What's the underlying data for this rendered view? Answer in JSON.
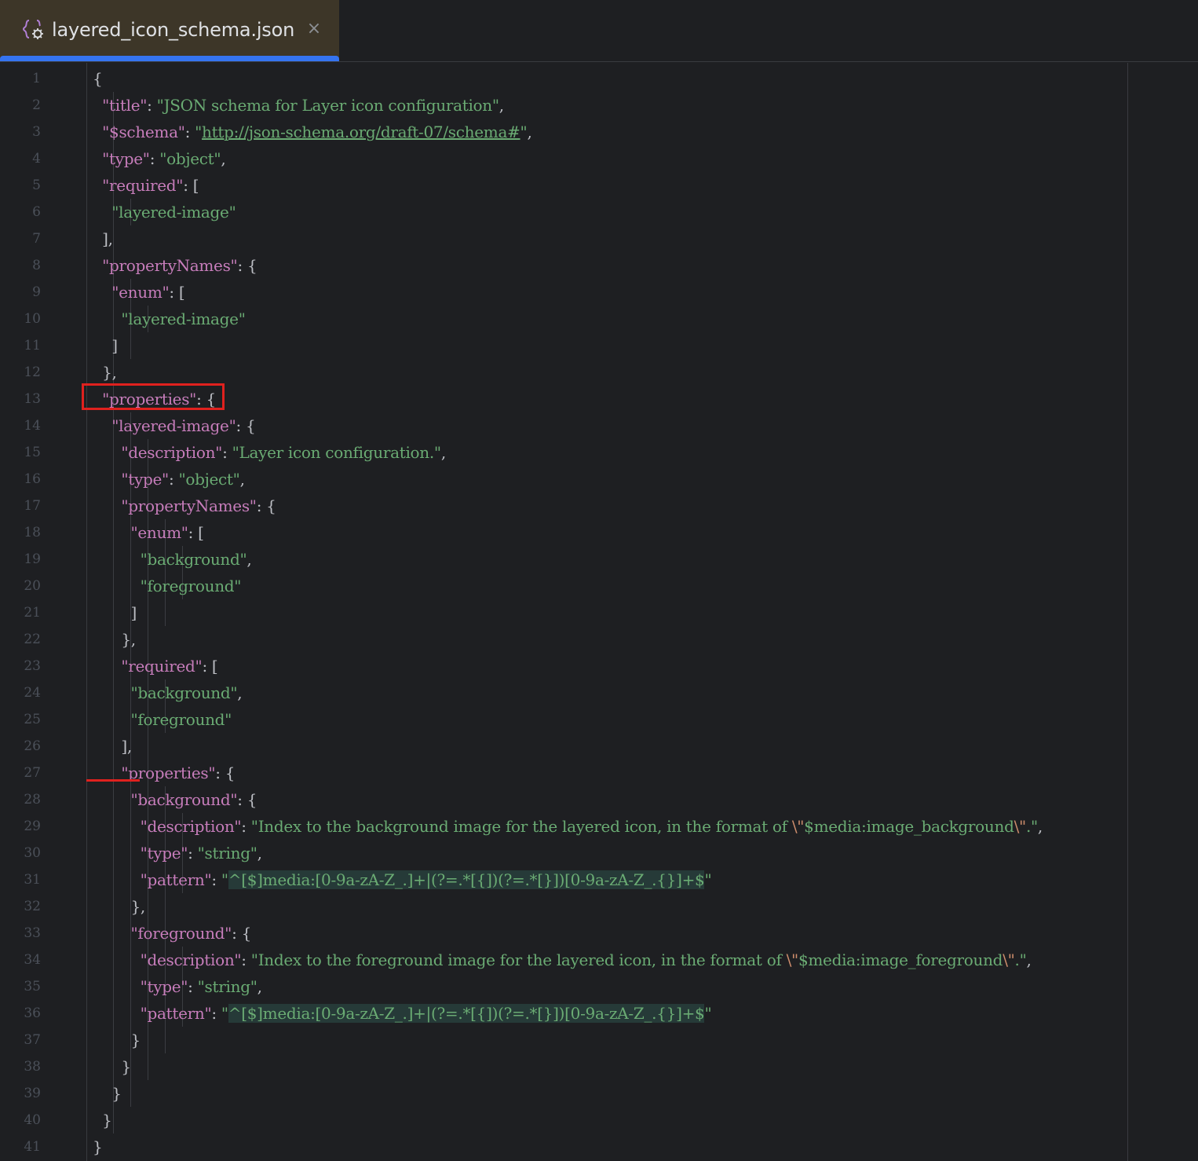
{
  "tab": {
    "title": "layered_icon_schema.json",
    "close": "×",
    "icon": "json-braces-icon"
  },
  "colors": {
    "key": "#c77dbb",
    "string": "#6aab73",
    "punct": "#bcbec4",
    "tab_accent": "#3574f0",
    "highlight": "#e0211e"
  },
  "lines": [
    [
      [
        "p",
        "{"
      ]
    ],
    [
      [
        "p",
        "  "
      ],
      [
        "k",
        "\"title\""
      ],
      [
        "p",
        ": "
      ],
      [
        "s",
        "\"JSON schema for Layer icon configuration\""
      ],
      [
        "p",
        ","
      ]
    ],
    [
      [
        "p",
        "  "
      ],
      [
        "k",
        "\"$schema\""
      ],
      [
        "p",
        ": "
      ],
      [
        "s",
        "\""
      ],
      [
        "u",
        "http://json-schema.org/draft-07/schema#"
      ],
      [
        "s",
        "\""
      ],
      [
        "p",
        ","
      ]
    ],
    [
      [
        "p",
        "  "
      ],
      [
        "k",
        "\"type\""
      ],
      [
        "p",
        ": "
      ],
      [
        "s",
        "\"object\""
      ],
      [
        "p",
        ","
      ]
    ],
    [
      [
        "p",
        "  "
      ],
      [
        "k",
        "\"required\""
      ],
      [
        "p",
        ": ["
      ]
    ],
    [
      [
        "p",
        "    "
      ],
      [
        "s",
        "\"layered-image\""
      ]
    ],
    [
      [
        "p",
        "  ],"
      ]
    ],
    [
      [
        "p",
        "  "
      ],
      [
        "k",
        "\"propertyNames\""
      ],
      [
        "p",
        ": {"
      ]
    ],
    [
      [
        "p",
        "    "
      ],
      [
        "k",
        "\"enum\""
      ],
      [
        "p",
        ": ["
      ]
    ],
    [
      [
        "p",
        "      "
      ],
      [
        "s",
        "\"layered-image\""
      ]
    ],
    [
      [
        "p",
        "    ]"
      ]
    ],
    [
      [
        "p",
        "  },"
      ]
    ],
    [
      [
        "p",
        "  "
      ],
      [
        "k",
        "\"properties\""
      ],
      [
        "p",
        ": {"
      ]
    ],
    [
      [
        "p",
        "    "
      ],
      [
        "k",
        "\"layered-image\""
      ],
      [
        "p",
        ": {"
      ]
    ],
    [
      [
        "p",
        "      "
      ],
      [
        "k",
        "\"description\""
      ],
      [
        "p",
        ": "
      ],
      [
        "s",
        "\"Layer icon configuration.\""
      ],
      [
        "p",
        ","
      ]
    ],
    [
      [
        "p",
        "      "
      ],
      [
        "k",
        "\"type\""
      ],
      [
        "p",
        ": "
      ],
      [
        "s",
        "\"object\""
      ],
      [
        "p",
        ","
      ]
    ],
    [
      [
        "p",
        "      "
      ],
      [
        "k",
        "\"propertyNames\""
      ],
      [
        "p",
        ": {"
      ]
    ],
    [
      [
        "p",
        "        "
      ],
      [
        "k",
        "\"enum\""
      ],
      [
        "p",
        ": ["
      ]
    ],
    [
      [
        "p",
        "          "
      ],
      [
        "s",
        "\"background\""
      ],
      [
        "p",
        ","
      ]
    ],
    [
      [
        "p",
        "          "
      ],
      [
        "s",
        "\"foreground\""
      ]
    ],
    [
      [
        "p",
        "        ]"
      ]
    ],
    [
      [
        "p",
        "      },"
      ]
    ],
    [
      [
        "p",
        "      "
      ],
      [
        "k",
        "\"required\""
      ],
      [
        "p",
        ": ["
      ]
    ],
    [
      [
        "p",
        "        "
      ],
      [
        "s",
        "\"background\""
      ],
      [
        "p",
        ","
      ]
    ],
    [
      [
        "p",
        "        "
      ],
      [
        "s",
        "\"foreground\""
      ]
    ],
    [
      [
        "p",
        "      ],"
      ]
    ],
    [
      [
        "p",
        "      "
      ],
      [
        "k",
        "\"properties\""
      ],
      [
        "p",
        ": {"
      ]
    ],
    [
      [
        "p",
        "        "
      ],
      [
        "k",
        "\"background\""
      ],
      [
        "p",
        ": {"
      ]
    ],
    [
      [
        "p",
        "          "
      ],
      [
        "k",
        "\"description\""
      ],
      [
        "p",
        ": "
      ],
      [
        "s",
        "\"Index to the background image for the layered icon, in the format of "
      ],
      [
        "esc",
        "\\\""
      ],
      [
        "s",
        "$media:image_background"
      ],
      [
        "esc",
        "\\\""
      ],
      [
        "s",
        ".\""
      ],
      [
        "p",
        ","
      ]
    ],
    [
      [
        "p",
        "          "
      ],
      [
        "k",
        "\"type\""
      ],
      [
        "p",
        ": "
      ],
      [
        "s",
        "\"string\""
      ],
      [
        "p",
        ","
      ]
    ],
    [
      [
        "p",
        "          "
      ],
      [
        "k",
        "\"pattern\""
      ],
      [
        "p",
        ": "
      ],
      [
        "s",
        "\""
      ],
      [
        "rx",
        "^[$]media:[0-9a-zA-Z_.]+|(?=.*[{])(?=.*[}])[0-9a-zA-Z_.{}]+$"
      ],
      [
        "s",
        "\""
      ]
    ],
    [
      [
        "p",
        "        },"
      ]
    ],
    [
      [
        "p",
        "        "
      ],
      [
        "k",
        "\"foreground\""
      ],
      [
        "p",
        ": {"
      ]
    ],
    [
      [
        "p",
        "          "
      ],
      [
        "k",
        "\"description\""
      ],
      [
        "p",
        ": "
      ],
      [
        "s",
        "\"Index to the foreground image for the layered icon, in the format of "
      ],
      [
        "esc",
        "\\\""
      ],
      [
        "s",
        "$media:image_foreground"
      ],
      [
        "esc",
        "\\\""
      ],
      [
        "s",
        ".\""
      ],
      [
        "p",
        ","
      ]
    ],
    [
      [
        "p",
        "          "
      ],
      [
        "k",
        "\"type\""
      ],
      [
        "p",
        ": "
      ],
      [
        "s",
        "\"string\""
      ],
      [
        "p",
        ","
      ]
    ],
    [
      [
        "p",
        "          "
      ],
      [
        "k",
        "\"pattern\""
      ],
      [
        "p",
        ": "
      ],
      [
        "s",
        "\""
      ],
      [
        "rx",
        "^[$]media:[0-9a-zA-Z_.]+|(?=.*[{])(?=.*[}])[0-9a-zA-Z_.{}]+$"
      ],
      [
        "s",
        "\""
      ]
    ],
    [
      [
        "p",
        "        }"
      ]
    ],
    [
      [
        "p",
        "      }"
      ]
    ],
    [
      [
        "p",
        "    }"
      ]
    ],
    [
      [
        "p",
        "  }"
      ]
    ],
    [
      [
        "p",
        "}"
      ]
    ]
  ]
}
